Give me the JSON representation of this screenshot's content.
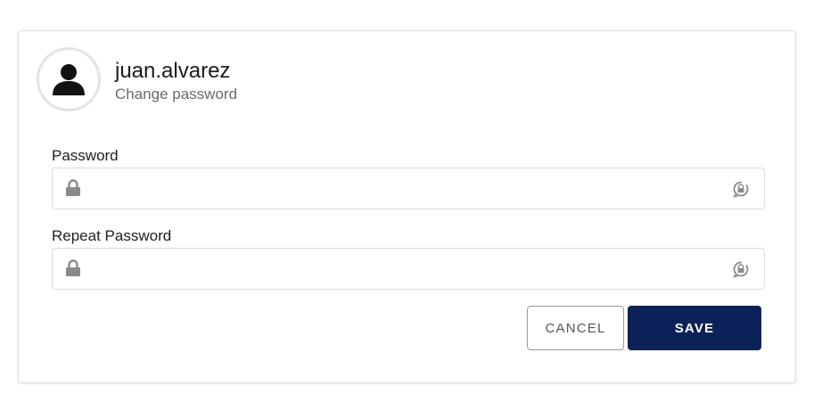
{
  "profile": {
    "username": "juan.alvarez",
    "subtitle": "Change password",
    "avatar_icon": "user-silhouette-icon"
  },
  "form": {
    "password": {
      "label": "Password",
      "value": "",
      "placeholder": "",
      "leading_icon": "lock-icon",
      "trailing_icon": "password-visibility-icon"
    },
    "repeat_password": {
      "label": "Repeat Password",
      "value": "",
      "placeholder": "",
      "leading_icon": "lock-icon",
      "trailing_icon": "password-visibility-icon"
    }
  },
  "actions": {
    "cancel_label": "CANCEL",
    "save_label": "SAVE"
  },
  "colors": {
    "primary": "#0c2157",
    "border": "#dcdcdc",
    "icon": "#8a8a8a",
    "muted_text": "#6a6a6a"
  }
}
